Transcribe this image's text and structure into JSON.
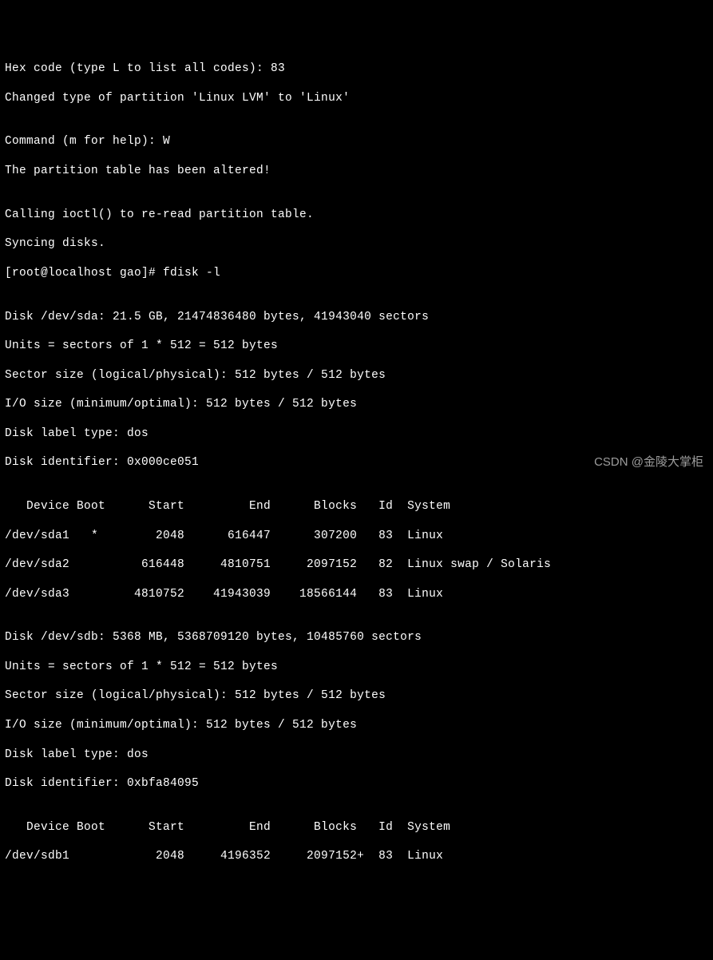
{
  "lines": {
    "l01": "Hex code (type L to list all codes): 83",
    "l02": "Changed type of partition 'Linux LVM' to 'Linux'",
    "l03": "",
    "l04": "Command (m for help): W",
    "l05": "The partition table has been altered!",
    "l06": "",
    "l07": "Calling ioctl() to re-read partition table.",
    "l08": "Syncing disks.",
    "l09": "[root@localhost gao]# fdisk -l",
    "l10": "",
    "l11": "Disk /dev/sda: 21.5 GB, 21474836480 bytes, 41943040 sectors",
    "l12": "Units = sectors of 1 * 512 = 512 bytes",
    "l13": "Sector size (logical/physical): 512 bytes / 512 bytes",
    "l14": "I/O size (minimum/optimal): 512 bytes / 512 bytes",
    "l15": "Disk label type: dos",
    "l16": "Disk identifier: 0x000ce051",
    "l17": "",
    "l18": "   Device Boot      Start         End      Blocks   Id  System",
    "l19": "/dev/sda1   *        2048      616447      307200   83  Linux",
    "l20": "/dev/sda2          616448     4810751     2097152   82  Linux swap / Solaris",
    "l21": "/dev/sda3         4810752    41943039    18566144   83  Linux",
    "l22": "",
    "l23": "Disk /dev/sdb: 5368 MB, 5368709120 bytes, 10485760 sectors",
    "l24": "Units = sectors of 1 * 512 = 512 bytes",
    "l25": "Sector size (logical/physical): 512 bytes / 512 bytes",
    "l26": "I/O size (minimum/optimal): 512 bytes / 512 bytes",
    "l27": "Disk label type: dos",
    "l28": "Disk identifier: 0xbfa84095",
    "l29": "",
    "l30": "   Device Boot      Start         End      Blocks   Id  System",
    "l31": "/dev/sdb1            2048     4196352     2097152+  83  Linux"
  },
  "watermark": "CSDN @金陵大掌柜"
}
